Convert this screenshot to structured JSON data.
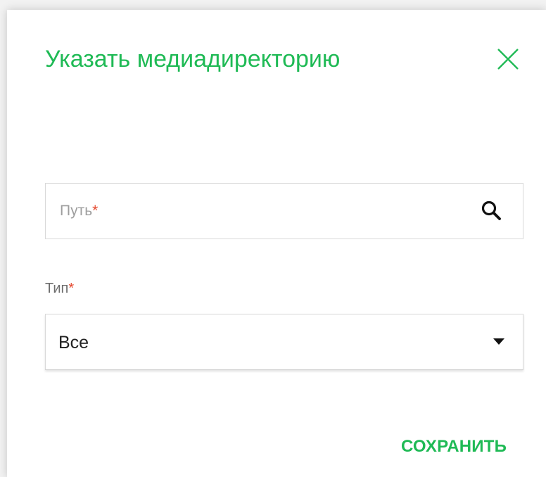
{
  "dialog": {
    "title": "Указать медиадиректорию",
    "close_icon": "close-icon"
  },
  "path_field": {
    "placeholder": "Путь",
    "required_mark": "*",
    "search_icon": "search-icon"
  },
  "type_field": {
    "label": "Тип",
    "required_mark": "*",
    "selected_value": "Все",
    "dropdown_icon": "caret-down-icon"
  },
  "actions": {
    "save_label": "СОХРАНИТЬ"
  },
  "colors": {
    "accent": "#1fba55",
    "required": "#e5492f"
  }
}
